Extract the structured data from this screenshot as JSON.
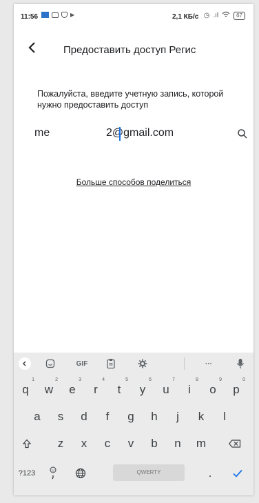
{
  "status_bar": {
    "time": "11:56",
    "network_speed": "2,1 КБ/с",
    "battery": "67"
  },
  "app_bar": {
    "back_icon": "back-arrow-icon",
    "title": "Предоставить доступ Регис"
  },
  "form": {
    "prompt": "Пожалуйста, введите учетную запись, которой нужно предоставить доступ",
    "account_prefix": "me",
    "account_value": "2@gmail.com",
    "search_icon": "search-icon"
  },
  "more_link": "Больше способов поделиться",
  "keyboard": {
    "toolbar": {
      "gif": "GIF",
      "more": "···"
    },
    "row1": [
      "q",
      "w",
      "e",
      "r",
      "t",
      "y",
      "u",
      "i",
      "o",
      "p"
    ],
    "row1_hints": [
      "1",
      "2",
      "3",
      "4",
      "5",
      "6",
      "7",
      "8",
      "9",
      "0"
    ],
    "row2": [
      "a",
      "s",
      "d",
      "f",
      "g",
      "h",
      "j",
      "k",
      "l"
    ],
    "row3": [
      "z",
      "x",
      "c",
      "v",
      "b",
      "n",
      "m"
    ],
    "symbols": "?123",
    "space_label": "QWERTY",
    "period": "."
  },
  "colors": {
    "accent": "#1a73e8",
    "keyboard_bg": "#ebebeb"
  }
}
